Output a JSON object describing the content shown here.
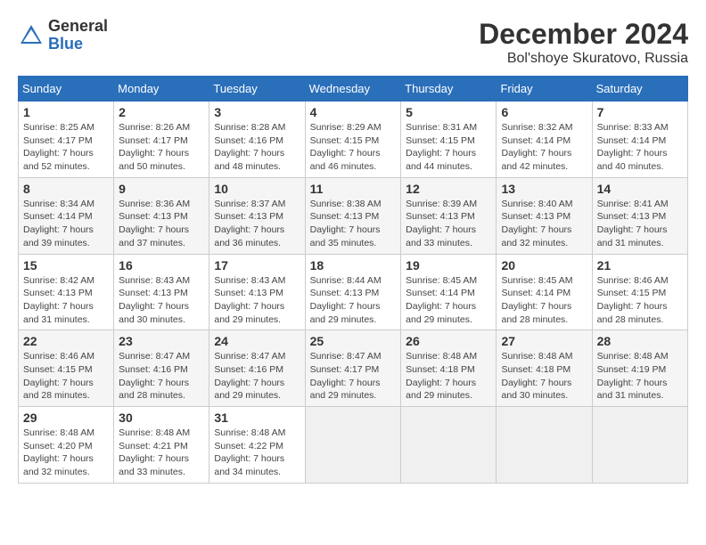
{
  "header": {
    "logo_general": "General",
    "logo_blue": "Blue",
    "month_title": "December 2024",
    "location": "Bol'shoye Skuratovo, Russia"
  },
  "weekdays": [
    "Sunday",
    "Monday",
    "Tuesday",
    "Wednesday",
    "Thursday",
    "Friday",
    "Saturday"
  ],
  "weeks": [
    [
      {
        "day": "1",
        "info": "Sunrise: 8:25 AM\nSunset: 4:17 PM\nDaylight: 7 hours\nand 52 minutes."
      },
      {
        "day": "2",
        "info": "Sunrise: 8:26 AM\nSunset: 4:17 PM\nDaylight: 7 hours\nand 50 minutes."
      },
      {
        "day": "3",
        "info": "Sunrise: 8:28 AM\nSunset: 4:16 PM\nDaylight: 7 hours\nand 48 minutes."
      },
      {
        "day": "4",
        "info": "Sunrise: 8:29 AM\nSunset: 4:15 PM\nDaylight: 7 hours\nand 46 minutes."
      },
      {
        "day": "5",
        "info": "Sunrise: 8:31 AM\nSunset: 4:15 PM\nDaylight: 7 hours\nand 44 minutes."
      },
      {
        "day": "6",
        "info": "Sunrise: 8:32 AM\nSunset: 4:14 PM\nDaylight: 7 hours\nand 42 minutes."
      },
      {
        "day": "7",
        "info": "Sunrise: 8:33 AM\nSunset: 4:14 PM\nDaylight: 7 hours\nand 40 minutes."
      }
    ],
    [
      {
        "day": "8",
        "info": "Sunrise: 8:34 AM\nSunset: 4:14 PM\nDaylight: 7 hours\nand 39 minutes."
      },
      {
        "day": "9",
        "info": "Sunrise: 8:36 AM\nSunset: 4:13 PM\nDaylight: 7 hours\nand 37 minutes."
      },
      {
        "day": "10",
        "info": "Sunrise: 8:37 AM\nSunset: 4:13 PM\nDaylight: 7 hours\nand 36 minutes."
      },
      {
        "day": "11",
        "info": "Sunrise: 8:38 AM\nSunset: 4:13 PM\nDaylight: 7 hours\nand 35 minutes."
      },
      {
        "day": "12",
        "info": "Sunrise: 8:39 AM\nSunset: 4:13 PM\nDaylight: 7 hours\nand 33 minutes."
      },
      {
        "day": "13",
        "info": "Sunrise: 8:40 AM\nSunset: 4:13 PM\nDaylight: 7 hours\nand 32 minutes."
      },
      {
        "day": "14",
        "info": "Sunrise: 8:41 AM\nSunset: 4:13 PM\nDaylight: 7 hours\nand 31 minutes."
      }
    ],
    [
      {
        "day": "15",
        "info": "Sunrise: 8:42 AM\nSunset: 4:13 PM\nDaylight: 7 hours\nand 31 minutes."
      },
      {
        "day": "16",
        "info": "Sunrise: 8:43 AM\nSunset: 4:13 PM\nDaylight: 7 hours\nand 30 minutes."
      },
      {
        "day": "17",
        "info": "Sunrise: 8:43 AM\nSunset: 4:13 PM\nDaylight: 7 hours\nand 29 minutes."
      },
      {
        "day": "18",
        "info": "Sunrise: 8:44 AM\nSunset: 4:13 PM\nDaylight: 7 hours\nand 29 minutes."
      },
      {
        "day": "19",
        "info": "Sunrise: 8:45 AM\nSunset: 4:14 PM\nDaylight: 7 hours\nand 29 minutes."
      },
      {
        "day": "20",
        "info": "Sunrise: 8:45 AM\nSunset: 4:14 PM\nDaylight: 7 hours\nand 28 minutes."
      },
      {
        "day": "21",
        "info": "Sunrise: 8:46 AM\nSunset: 4:15 PM\nDaylight: 7 hours\nand 28 minutes."
      }
    ],
    [
      {
        "day": "22",
        "info": "Sunrise: 8:46 AM\nSunset: 4:15 PM\nDaylight: 7 hours\nand 28 minutes."
      },
      {
        "day": "23",
        "info": "Sunrise: 8:47 AM\nSunset: 4:16 PM\nDaylight: 7 hours\nand 28 minutes."
      },
      {
        "day": "24",
        "info": "Sunrise: 8:47 AM\nSunset: 4:16 PM\nDaylight: 7 hours\nand 29 minutes."
      },
      {
        "day": "25",
        "info": "Sunrise: 8:47 AM\nSunset: 4:17 PM\nDaylight: 7 hours\nand 29 minutes."
      },
      {
        "day": "26",
        "info": "Sunrise: 8:48 AM\nSunset: 4:18 PM\nDaylight: 7 hours\nand 29 minutes."
      },
      {
        "day": "27",
        "info": "Sunrise: 8:48 AM\nSunset: 4:18 PM\nDaylight: 7 hours\nand 30 minutes."
      },
      {
        "day": "28",
        "info": "Sunrise: 8:48 AM\nSunset: 4:19 PM\nDaylight: 7 hours\nand 31 minutes."
      }
    ],
    [
      {
        "day": "29",
        "info": "Sunrise: 8:48 AM\nSunset: 4:20 PM\nDaylight: 7 hours\nand 32 minutes."
      },
      {
        "day": "30",
        "info": "Sunrise: 8:48 AM\nSunset: 4:21 PM\nDaylight: 7 hours\nand 33 minutes."
      },
      {
        "day": "31",
        "info": "Sunrise: 8:48 AM\nSunset: 4:22 PM\nDaylight: 7 hours\nand 34 minutes."
      },
      {
        "day": "",
        "info": ""
      },
      {
        "day": "",
        "info": ""
      },
      {
        "day": "",
        "info": ""
      },
      {
        "day": "",
        "info": ""
      }
    ]
  ]
}
